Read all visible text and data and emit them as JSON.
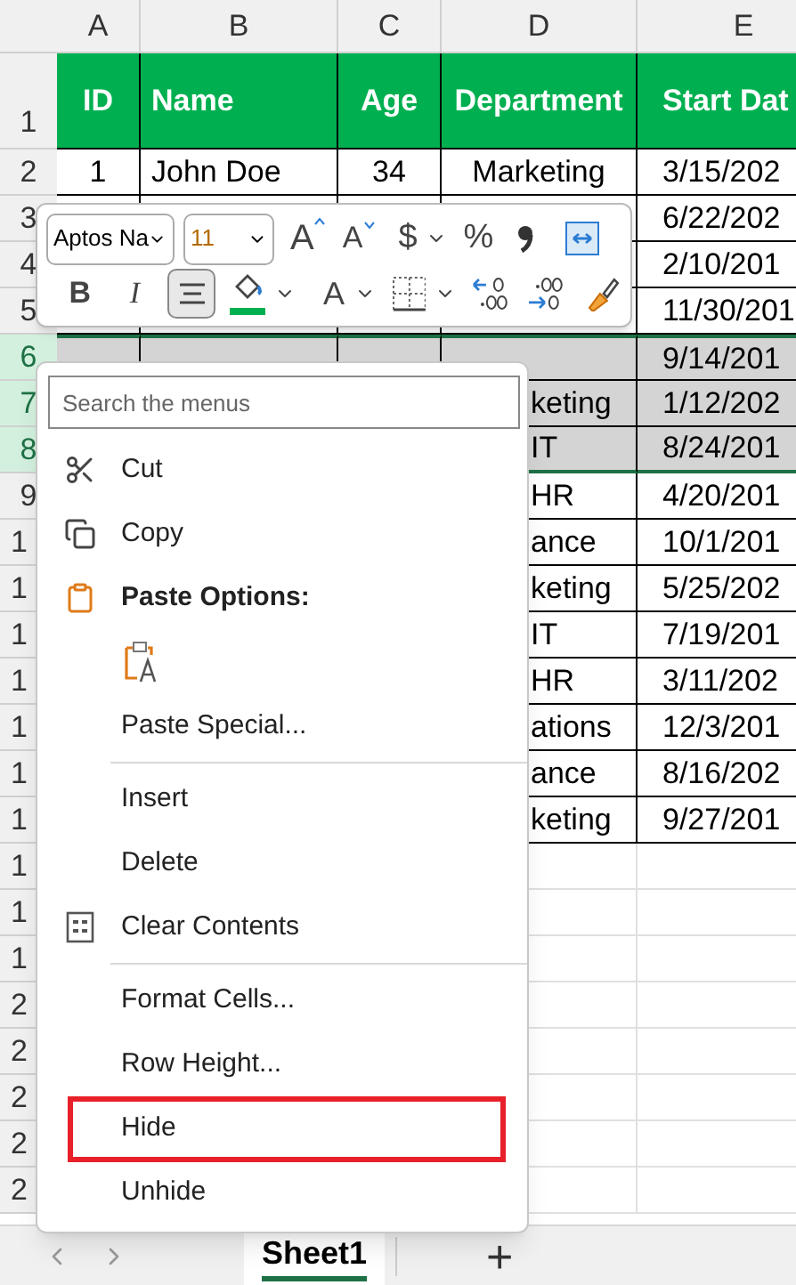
{
  "columns": [
    "A",
    "B",
    "C",
    "D",
    "E"
  ],
  "header_row": {
    "row": "1",
    "cells": [
      "ID",
      "Name",
      "Age",
      "Department",
      "Start Dat"
    ]
  },
  "rows": [
    {
      "row": "2",
      "selected": false,
      "cells": {
        "A": "1",
        "B": "John Doe",
        "C": "34",
        "D": "Marketing",
        "E": "3/15/202"
      }
    },
    {
      "row": "3",
      "selected": false,
      "cells": {
        "E": "6/22/202"
      }
    },
    {
      "row": "4",
      "selected": false,
      "cells": {
        "E": "2/10/201"
      }
    },
    {
      "row": "5",
      "selected": false,
      "cells": {
        "E": "11/30/201"
      }
    },
    {
      "row": "6",
      "selected": true,
      "cells": {
        "E": "9/14/201"
      }
    },
    {
      "row": "7",
      "selected": true,
      "cells": {
        "D": "keting",
        "E": "1/12/202"
      }
    },
    {
      "row": "8",
      "selected": true,
      "cells": {
        "D": "IT",
        "E": "8/24/201"
      }
    },
    {
      "row": "9",
      "selected": false,
      "cells": {
        "D": "HR",
        "E": "4/20/201"
      }
    },
    {
      "row": "1",
      "selected": false,
      "cells": {
        "D": "ance",
        "E": "10/1/201"
      }
    },
    {
      "row": "1",
      "selected": false,
      "cells": {
        "D": "keting",
        "E": "5/25/202"
      }
    },
    {
      "row": "1",
      "selected": false,
      "cells": {
        "D": "IT",
        "E": "7/19/201"
      }
    },
    {
      "row": "1",
      "selected": false,
      "cells": {
        "D": "HR",
        "E": "3/11/202"
      }
    },
    {
      "row": "1",
      "selected": false,
      "cells": {
        "D": "ations",
        "E": "12/3/201"
      }
    },
    {
      "row": "1",
      "selected": false,
      "cells": {
        "D": "ance",
        "E": "8/16/202"
      }
    },
    {
      "row": "1",
      "selected": false,
      "cells": {
        "D": "keting",
        "E": "9/27/201"
      }
    }
  ],
  "empty_rows": [
    "1",
    "1",
    "1",
    "2",
    "2",
    "2",
    "2",
    "2"
  ],
  "mini_toolbar": {
    "font": "Aptos Na",
    "size": "11",
    "grow_font": "A",
    "shrink_font": "A",
    "currency": "$",
    "percent": "%",
    "bold": "B",
    "italic": "I",
    "font_color": "A",
    "center_align_on": true
  },
  "context_menu": {
    "search_placeholder": "Search the menus",
    "groups": [
      [
        {
          "kind": "command",
          "label": "Cut",
          "highlighted": false
        },
        {
          "kind": "command",
          "label": "Copy",
          "highlighted": false
        },
        {
          "kind": "header",
          "label": "Paste Options:"
        },
        {
          "kind": "paste_option"
        },
        {
          "kind": "command",
          "label": "Paste Special...",
          "highlighted": false
        }
      ],
      [
        {
          "kind": "command",
          "label": "Insert",
          "highlighted": false
        },
        {
          "kind": "command",
          "label": "Delete",
          "highlighted": false
        },
        {
          "kind": "command",
          "label": "Clear Contents",
          "highlighted": false
        }
      ],
      [
        {
          "kind": "command",
          "label": "Format Cells...",
          "highlighted": false
        },
        {
          "kind": "command",
          "label": "Row Height...",
          "highlighted": false
        },
        {
          "kind": "command",
          "label": "Hide",
          "highlighted": true
        },
        {
          "kind": "command",
          "label": "Unhide",
          "highlighted": false
        }
      ]
    ]
  },
  "sheet_tabs": [
    {
      "label": "Sheet1",
      "selected": true
    }
  ],
  "add_sheet": "+"
}
